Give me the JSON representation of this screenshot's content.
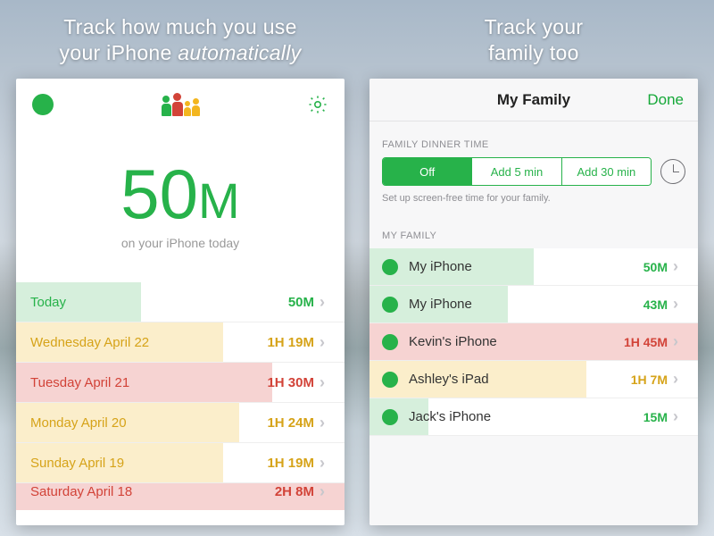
{
  "left": {
    "headline_html": "Track how much you use<br>your iPhone <em>automatically</em>",
    "big_number": "50",
    "big_unit": "M",
    "subtext": "on your iPhone today",
    "days": [
      {
        "label": "Today",
        "value": "50M",
        "tone": "green",
        "fill": 38
      },
      {
        "label": "Wednesday April 22",
        "value": "1H 19M",
        "tone": "amber",
        "fill": 63
      },
      {
        "label": "Tuesday April 21",
        "value": "1H 30M",
        "tone": "red",
        "fill": 78
      },
      {
        "label": "Monday April 20",
        "value": "1H 24M",
        "tone": "amber",
        "fill": 68
      },
      {
        "label": "Sunday April 19",
        "value": "1H 19M",
        "tone": "amber",
        "fill": 63
      },
      {
        "label": "Saturday April 18",
        "value": "2H 8M",
        "tone": "red",
        "fill": 100
      }
    ]
  },
  "right": {
    "headline_html": "Track your<br>family too",
    "nav_title": "My Family",
    "nav_done": "Done",
    "section_dinner": "FAMILY DINNER TIME",
    "segments": [
      "Off",
      "Add 5 min",
      "Add 30 min"
    ],
    "seg_help": "Set up screen-free time for your family.",
    "section_family": "MY FAMILY",
    "members": [
      {
        "name": "My iPhone",
        "value": "50M",
        "tone": "green",
        "fill": 50
      },
      {
        "name": "My iPhone",
        "value": "43M",
        "tone": "green",
        "fill": 42
      },
      {
        "name": "Kevin's iPhone",
        "value": "1H 45M",
        "tone": "red",
        "fill": 100
      },
      {
        "name": "Ashley's iPad",
        "value": "1H 7M",
        "tone": "amber",
        "fill": 66
      },
      {
        "name": "Jack's iPhone",
        "value": "15M",
        "tone": "green",
        "fill": 18
      }
    ]
  }
}
